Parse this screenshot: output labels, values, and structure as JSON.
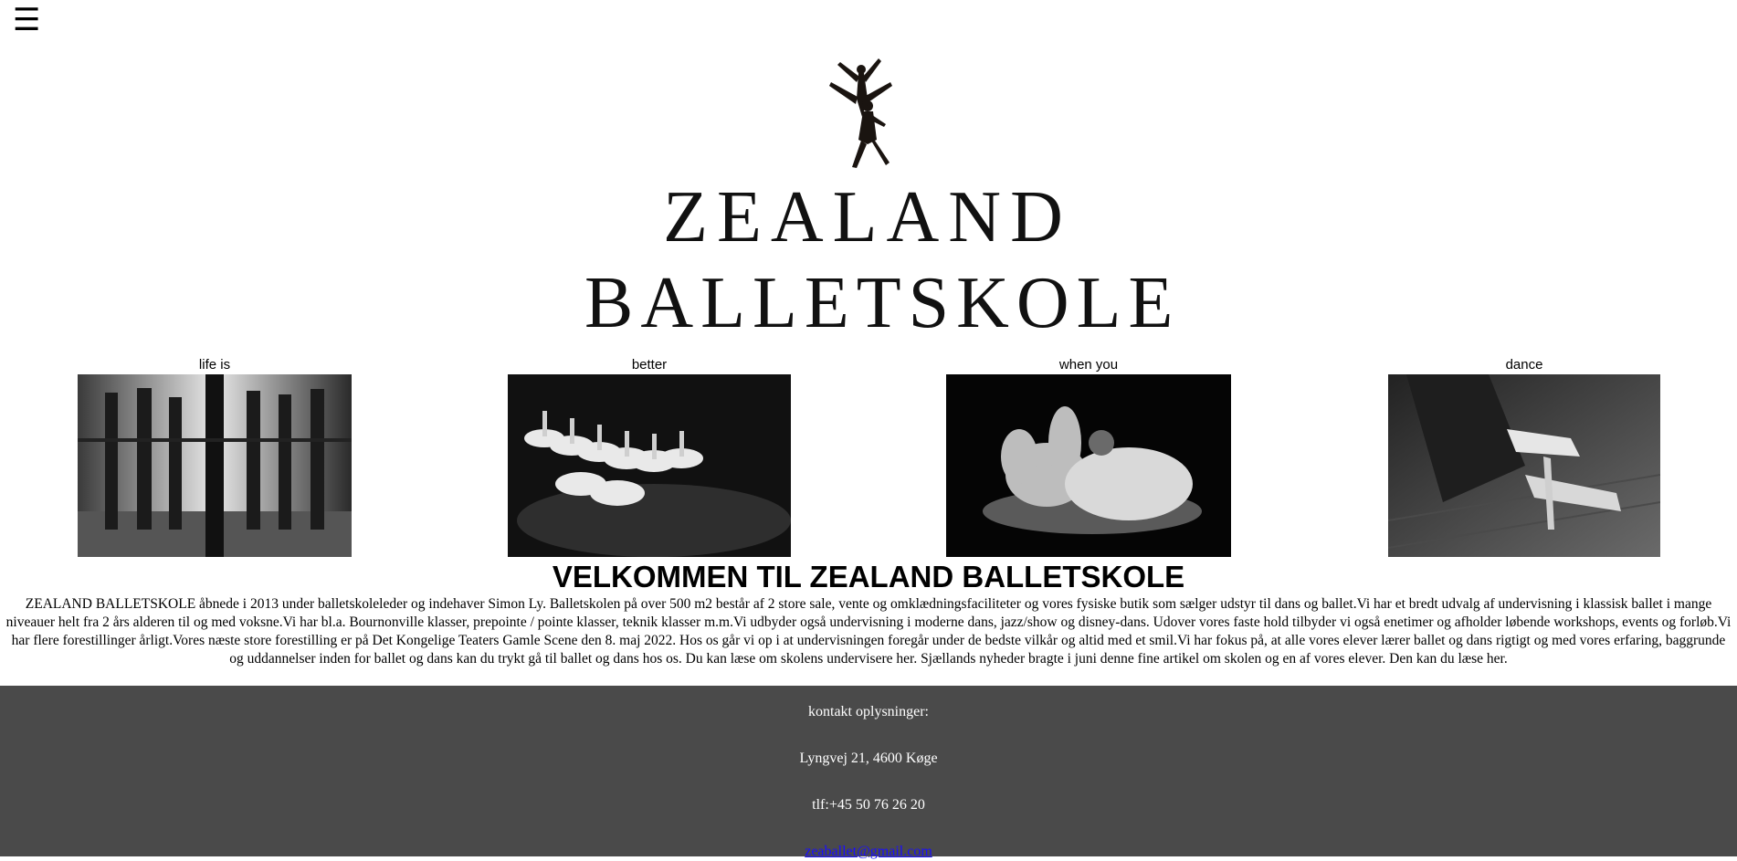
{
  "header": {
    "menu_glyph": "☰"
  },
  "logo": {
    "line1": "ZEALAND",
    "line2": "BALLETSKOLE"
  },
  "gallery": [
    {
      "caption": "life is"
    },
    {
      "caption": "better"
    },
    {
      "caption": "when you"
    },
    {
      "caption": "dance"
    }
  ],
  "welcome": {
    "title": "VELKOMMEN TIL ZEALAND BALLETSKOLE",
    "body": "ZEALAND BALLETSKOLE åbnede i 2013 under balletskoleleder og indehaver Simon Ly. Balletskolen på over 500 m2 består af 2 store sale, vente og omklædningsfaciliteter og vores fysiske butik som sælger udstyr til dans og ballet.Vi har et bredt udvalg af undervisning i klassisk ballet i mange niveauer helt fra 2 års alderen til og med voksne.Vi har bl.a. Bournonville klasser, prepointe / pointe klasser, teknik klasser m.m.Vi udbyder også undervisning i moderne dans, jazz/show og disney-dans. Udover vores faste hold tilbyder vi også enetimer og afholder løbende workshops, events og forløb.Vi har flere forestillinger årligt.Vores næste store forestilling er på Det Kongelige Teaters Gamle Scene den 8. maj 2022. Hos os går vi op i at undervisningen foregår under de bedste vilkår og altid med et smil.Vi har fokus på, at alle vores elever lærer ballet og dans rigtigt og med vores erfaring, baggrunde og uddannelser inden for ballet og dans kan du trykt gå til ballet og dans hos os. Du kan læse om skolens undervisere ",
    "link1": "her",
    "middle": ". Sjællands nyheder bragte i juni denne fine artikel om skolen og en af vores elever. Den kan du læse ",
    "link2": "her",
    "end": "."
  },
  "footer": {
    "heading": "kontakt oplysninger:",
    "address": "Lyngvej 21, 4600 Køge",
    "phone": "tlf:+45 50 76 26 20",
    "email": "zeaballet@gmail.com"
  },
  "colors": {
    "footer_bg": "#4a4a4a",
    "footer_text": "#ffffff",
    "link": "#1a0dff"
  }
}
